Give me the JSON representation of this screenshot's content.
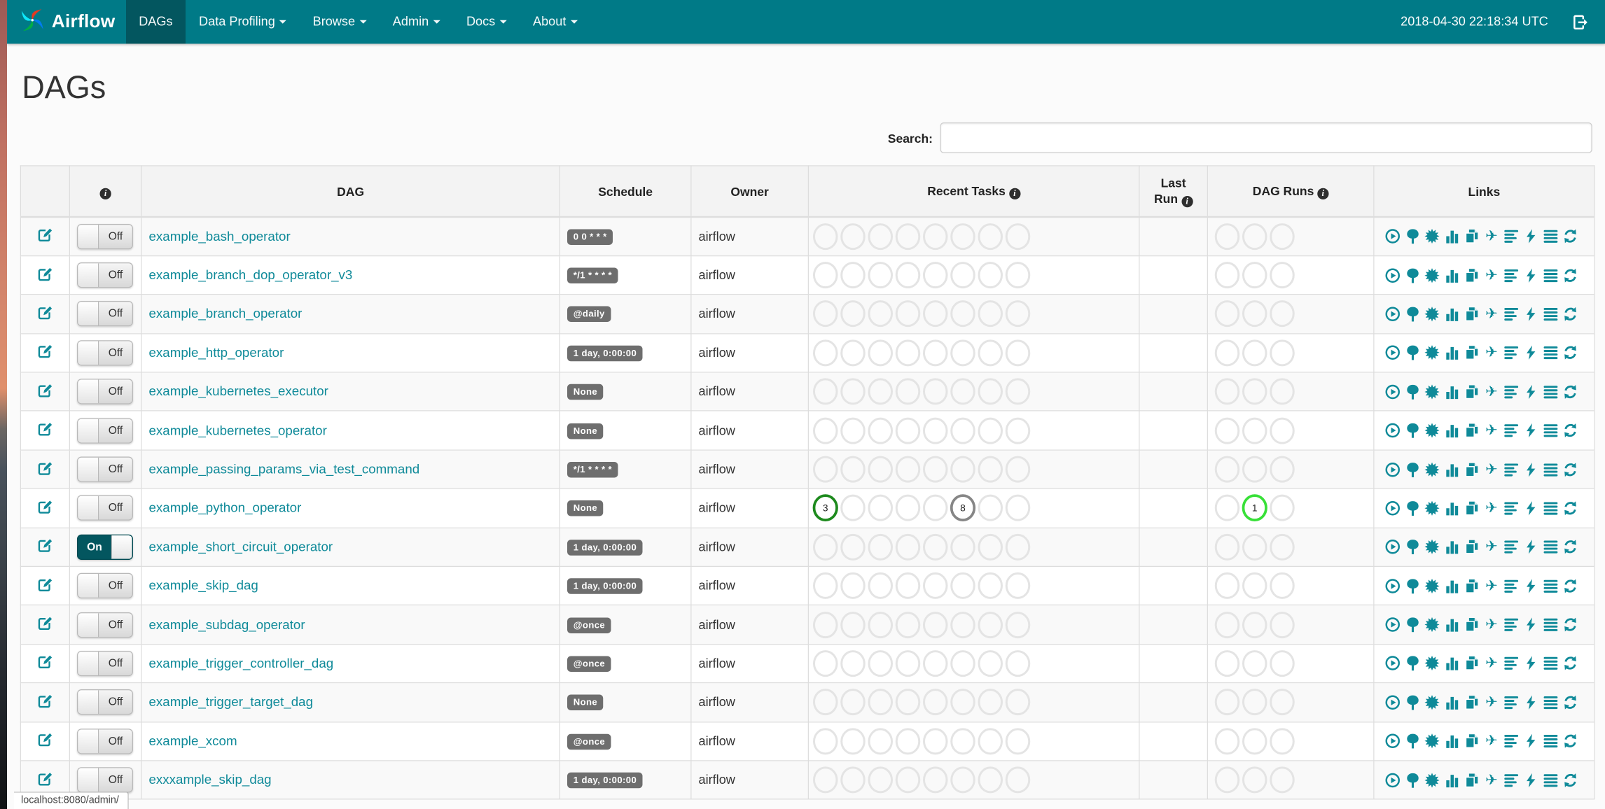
{
  "navbar": {
    "brand": "Airflow",
    "items": [
      {
        "label": "DAGs",
        "active": true,
        "caret": false
      },
      {
        "label": "Data Profiling",
        "active": false,
        "caret": true
      },
      {
        "label": "Browse",
        "active": false,
        "caret": true
      },
      {
        "label": "Admin",
        "active": false,
        "caret": true
      },
      {
        "label": "Docs",
        "active": false,
        "caret": true
      },
      {
        "label": "About",
        "active": false,
        "caret": true
      }
    ],
    "clock": "2018-04-30 22:18:34 UTC"
  },
  "page": {
    "title": "DAGs",
    "search_label": "Search:",
    "search_value": "",
    "status_bar": "localhost:8080/admin/"
  },
  "table": {
    "headers": [
      {
        "label": "",
        "info": false
      },
      {
        "label": "",
        "info": true
      },
      {
        "label": "DAG",
        "info": false
      },
      {
        "label": "Schedule",
        "info": false
      },
      {
        "label": "Owner",
        "info": false
      },
      {
        "label": "Recent Tasks",
        "info": true
      },
      {
        "label": "Last\nRun",
        "info": true
      },
      {
        "label": "DAG Runs",
        "info": true
      },
      {
        "label": "Links",
        "info": false
      }
    ],
    "toggle_on_label": "On",
    "toggle_off_label": "Off",
    "recent_tasks_slots": 8,
    "dag_runs_slots": 3,
    "links": [
      "trigger-dag",
      "tree-view",
      "graph-view",
      "tasks-duration",
      "task-tries",
      "landing-times",
      "gantt-view",
      "code-view",
      "logs",
      "refresh"
    ],
    "rows": [
      {
        "dag": "example_bash_operator",
        "toggle": "off",
        "schedule": "0 0 * * *",
        "owner": "airflow",
        "recent_tasks": [],
        "dag_runs": []
      },
      {
        "dag": "example_branch_dop_operator_v3",
        "toggle": "off",
        "schedule": "*/1 * * * *",
        "owner": "airflow",
        "recent_tasks": [],
        "dag_runs": []
      },
      {
        "dag": "example_branch_operator",
        "toggle": "off",
        "schedule": "@daily",
        "owner": "airflow",
        "recent_tasks": [],
        "dag_runs": []
      },
      {
        "dag": "example_http_operator",
        "toggle": "off",
        "schedule": "1 day, 0:00:00",
        "owner": "airflow",
        "recent_tasks": [],
        "dag_runs": []
      },
      {
        "dag": "example_kubernetes_executor",
        "toggle": "off",
        "schedule": "None",
        "owner": "airflow",
        "recent_tasks": [],
        "dag_runs": []
      },
      {
        "dag": "example_kubernetes_operator",
        "toggle": "off",
        "schedule": "None",
        "owner": "airflow",
        "recent_tasks": [],
        "dag_runs": []
      },
      {
        "dag": "example_passing_params_via_test_command",
        "toggle": "off",
        "schedule": "*/1 * * * *",
        "owner": "airflow",
        "recent_tasks": [],
        "dag_runs": []
      },
      {
        "dag": "example_python_operator",
        "toggle": "off",
        "schedule": "None",
        "owner": "airflow",
        "recent_tasks": [
          {
            "slot": 0,
            "count": 3,
            "state": "success"
          },
          {
            "slot": 5,
            "count": 8,
            "state": "queued"
          }
        ],
        "dag_runs": [
          {
            "slot": 1,
            "count": 1,
            "state": "running"
          }
        ]
      },
      {
        "dag": "example_short_circuit_operator",
        "toggle": "on",
        "schedule": "1 day, 0:00:00",
        "owner": "airflow",
        "recent_tasks": [],
        "dag_runs": []
      },
      {
        "dag": "example_skip_dag",
        "toggle": "off",
        "schedule": "1 day, 0:00:00",
        "owner": "airflow",
        "recent_tasks": [],
        "dag_runs": []
      },
      {
        "dag": "example_subdag_operator",
        "toggle": "off",
        "schedule": "@once",
        "owner": "airflow",
        "recent_tasks": [],
        "dag_runs": []
      },
      {
        "dag": "example_trigger_controller_dag",
        "toggle": "off",
        "schedule": "@once",
        "owner": "airflow",
        "recent_tasks": [],
        "dag_runs": []
      },
      {
        "dag": "example_trigger_target_dag",
        "toggle": "off",
        "schedule": "None",
        "owner": "airflow",
        "recent_tasks": [],
        "dag_runs": []
      },
      {
        "dag": "example_xcom",
        "toggle": "off",
        "schedule": "@once",
        "owner": "airflow",
        "recent_tasks": [],
        "dag_runs": []
      },
      {
        "dag": "exxxample_skip_dag",
        "toggle": "off",
        "schedule": "1 day, 0:00:00",
        "owner": "airflow",
        "recent_tasks": [],
        "dag_runs": []
      }
    ]
  },
  "colors": {
    "navbar": "#007A87",
    "navbar_active": "#03565F",
    "accent": "#0f8a99",
    "link": "#0f8a99",
    "badge_bg": "#6e6e6e",
    "state_success": "#1d8a1d",
    "state_running": "#38e038",
    "state_queued": "#868686",
    "circle_empty": "#e4e4e4"
  }
}
